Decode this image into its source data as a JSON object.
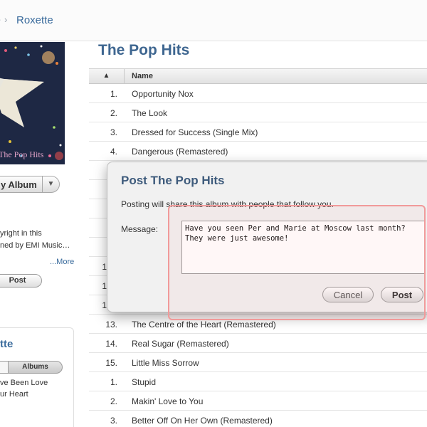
{
  "breadcrumb": {
    "link": "Roxette"
  },
  "album": {
    "art_title": "The Pop Hits",
    "buy_label": "y Album",
    "copyright_lines": [
      "yright in this",
      "ned by EMI Music…"
    ],
    "more_link": "...More",
    "post_label": "Post"
  },
  "artist_panel": {
    "name": "tte",
    "tab_albums": "Albums",
    "items": [
      "ve Been Love",
      "ur Heart"
    ]
  },
  "main": {
    "title": "The Pop Hits",
    "header": {
      "sort_indicator": "▲",
      "name": "Name"
    },
    "rows": [
      {
        "num": "1.",
        "title": "Opportunity Nox"
      },
      {
        "num": "2.",
        "title": "The Look"
      },
      {
        "num": "3.",
        "title": "Dressed for Success (Single Mix)"
      },
      {
        "num": "4.",
        "title": "Dangerous (Remastered)"
      },
      {
        "num": "13.",
        "title": "The Centre of the Heart (Remastered)"
      },
      {
        "num": "14.",
        "title": "Real Sugar (Remastered)"
      },
      {
        "num": "15.",
        "title": "Little Miss Sorrow"
      },
      {
        "num": "1.",
        "title": "Stupid"
      },
      {
        "num": "2.",
        "title": "Makin' Love to You"
      },
      {
        "num": "3.",
        "title": "Better Off On Her Own (Remastered)"
      }
    ],
    "hidden_row_fragments": [
      "1",
      "1",
      "1"
    ]
  },
  "dialog": {
    "title": "Post The Pop Hits",
    "description": "Posting will share this album with people that follow you.",
    "message_label": "Message:",
    "message_value": "Have you seen Per and Marie at Moscow last month? They were just awesome!",
    "cancel_label": "Cancel",
    "post_label": "Post"
  },
  "colors": {
    "link": "#3a6b9c",
    "title": "#3e6690",
    "highlight": "#f19a9a"
  }
}
